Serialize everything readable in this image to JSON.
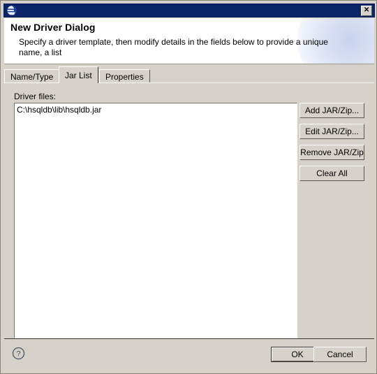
{
  "window": {
    "title_icon": "eclipse-logo-icon",
    "close_label": "✕",
    "close_icon": "close-icon"
  },
  "banner": {
    "title": "New Driver Dialog",
    "description": "Specify a driver template, then modify details in the fields below to provide a unique name, a list"
  },
  "tabs": [
    {
      "label": "Name/Type",
      "selected": false
    },
    {
      "label": "Jar List",
      "selected": true
    },
    {
      "label": "Properties",
      "selected": false
    }
  ],
  "panel": {
    "field_label": "Driver files:",
    "driver_files": [
      "C:\\hsqldb\\lib\\hsqldb.jar"
    ]
  },
  "side_buttons": [
    {
      "label": "Add JAR/Zip..."
    },
    {
      "label": "Edit JAR/Zip..."
    },
    {
      "label": "Remove JAR/Zip"
    },
    {
      "label": "Clear All"
    }
  ],
  "footer": {
    "help_icon": "help-question-icon",
    "ok_label": "OK",
    "cancel_label": "Cancel"
  },
  "colors": {
    "titlebar": "#0b2468",
    "dialog_bg": "#d6d2ca",
    "banner_bg": "#ffffff",
    "banner_glow": "#c7d2ee",
    "list_bg": "#ffffff",
    "text": "#000000",
    "separator": "#3b3833"
  }
}
